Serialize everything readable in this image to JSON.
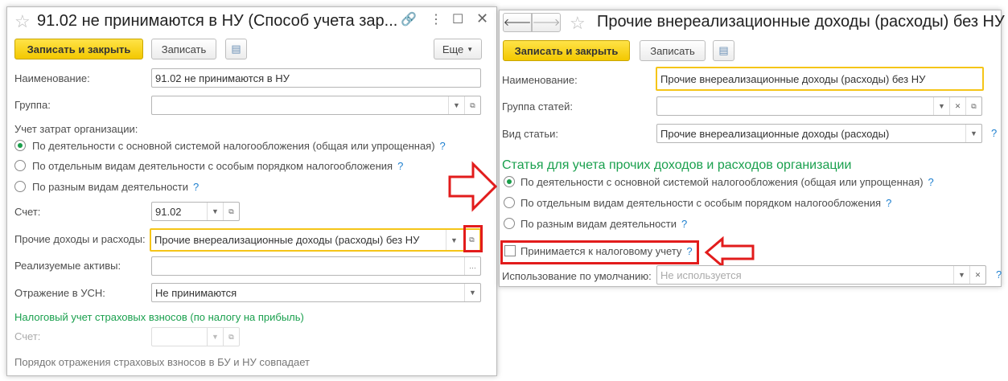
{
  "left": {
    "title": "91.02 не принимаются в НУ (Способ учета зар...",
    "save_close": "Записать и закрыть",
    "save": "Записать",
    "more": "Еще",
    "name_label": "Наименование:",
    "name_value": "91.02 не принимаются в НУ",
    "group_label": "Группа:",
    "cost_label": "Учет затрат организации:",
    "radios": [
      "По деятельности с основной системой налогообложения (общая или упрощенная)",
      "По отдельным видам деятельности с особым порядком налогообложения",
      "По разным видам деятельности"
    ],
    "account_label": "Счет:",
    "account_value": "91.02",
    "other_label": "Прочие доходы и расходы:",
    "other_value": "Прочие внереализационные доходы (расходы) без НУ",
    "assets_label": "Реализуемые активы:",
    "usn_label": "Отражение в УСН:",
    "usn_value": "Не принимаются",
    "insurance_heading": "Налоговый учет страховых взносов (по налогу на прибыль)",
    "ins_account_label": "Счет:",
    "note": "Порядок отражения страховых взносов в БУ и НУ совпадает"
  },
  "right": {
    "title": "Прочие внереализационные доходы (расходы) без НУ ...",
    "save_close": "Записать и закрыть",
    "save": "Записать",
    "name_label": "Наименование:",
    "name_value": "Прочие внереализационные доходы (расходы) без НУ",
    "group_label": "Группа статей:",
    "kind_label": "Вид статьи:",
    "kind_value": "Прочие внереализационные доходы (расходы)",
    "heading": "Статья для учета прочих доходов и расходов организации",
    "radios": [
      "По деятельности с основной системой налогообложения (общая или упрощенная)",
      "По отдельным видам деятельности с особым порядком налогообложения",
      "По разным видам деятельности"
    ],
    "tax_checkbox": "Принимается к налоговому учету",
    "default_label": "Использование по умолчанию:",
    "default_placeholder": "Не используется"
  },
  "help": "?",
  "colors": {
    "accent": "#f3c800",
    "green": "#1aa04e",
    "annotation": "#e21c1c"
  }
}
